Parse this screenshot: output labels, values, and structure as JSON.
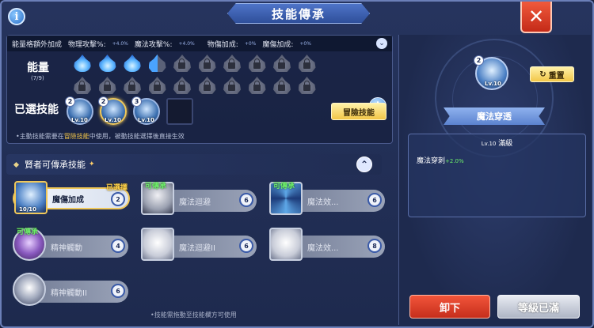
{
  "header": {
    "title": "技能傳承",
    "info_icon": "info-icon",
    "close_icon": "close-icon"
  },
  "stats": {
    "label": "能量格額外加成",
    "items": [
      {
        "label": "物理攻擊%:",
        "value": "+4.0%"
      },
      {
        "label": "魔法攻擊%:",
        "value": "+4.0%"
      },
      {
        "label": "物傷加成:",
        "value": "+0%"
      },
      {
        "label": "魔傷加成:",
        "value": "+0%"
      }
    ]
  },
  "energy": {
    "label": "能量",
    "count": "(7/9)",
    "filled": 3,
    "half": 1,
    "total_row1": 10,
    "total_row2": 10
  },
  "selected_skills": {
    "label": "已選技能",
    "slots": [
      {
        "num": "2",
        "lv": "Lv.10"
      },
      {
        "num": "2",
        "lv": "Lv.10"
      },
      {
        "num": "3",
        "lv": "Lv.10"
      }
    ],
    "adventure_button": "冒險技能"
  },
  "hint": {
    "prefix": "•主動技能需要在",
    "highlight": "冒險技能",
    "suffix": "中使用，被動技能選擇後直接生效"
  },
  "section": {
    "title": "賢者可傳承技能",
    "star": "✦"
  },
  "skill_list": [
    {
      "name": "魔傷加成",
      "count": "2",
      "lv": "10/10",
      "tag": "已選擇"
    },
    {
      "name": "魔法迴避",
      "count": "6",
      "tag": "可傳承"
    },
    {
      "name": "魔法效...",
      "count": "6",
      "tag": "可傳承"
    },
    {
      "name": "精神觸動",
      "count": "4",
      "tag": "可傳承"
    },
    {
      "name": "魔法迴避II",
      "count": "6",
      "tag": ""
    },
    {
      "name": "魔法效...",
      "count": "8",
      "tag": ""
    },
    {
      "name": "精神觸動II",
      "count": "6",
      "tag": ""
    }
  ],
  "bottom_hint": "•技能需拖動至技能欄方可使用",
  "detail": {
    "skill_num": "2",
    "skill_lv": "Lv.10",
    "reset_label": "重置",
    "skill_name": "魔法穿透",
    "level_small": "Lv.10",
    "level_text": "滿級",
    "effect_label": "魔法穿刺",
    "effect_value": "+2.0%"
  },
  "buttons": {
    "unequip": "卸下",
    "max_level": "等級已滿"
  }
}
